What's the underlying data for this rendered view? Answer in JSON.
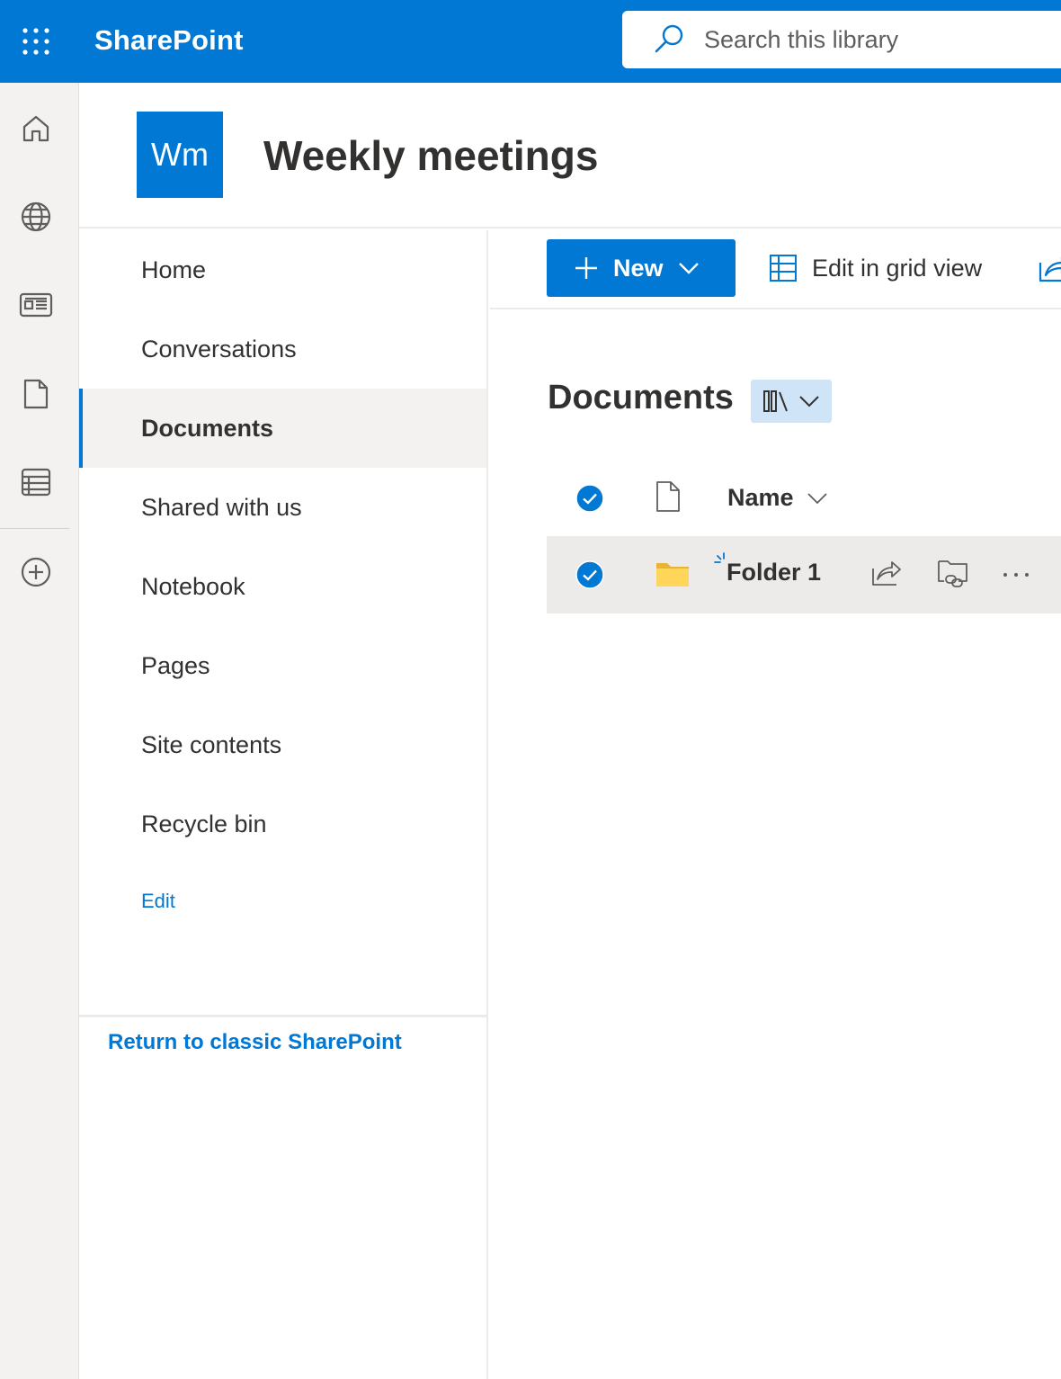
{
  "suite_bar": {
    "app_name": "SharePoint",
    "search_placeholder": "Search this library",
    "colors": {
      "brand": "#0078d4"
    }
  },
  "app_bar": {
    "items": [
      "home-icon",
      "globe-icon",
      "news-icon",
      "document-icon",
      "list-icon",
      "add-circle-icon"
    ]
  },
  "site": {
    "logo_text": "Wm",
    "title": "Weekly meetings"
  },
  "left_nav": {
    "items": [
      {
        "label": "Home",
        "selected": false
      },
      {
        "label": "Conversations",
        "selected": false
      },
      {
        "label": "Documents",
        "selected": true
      },
      {
        "label": "Shared with us",
        "selected": false
      },
      {
        "label": "Notebook",
        "selected": false
      },
      {
        "label": "Pages",
        "selected": false
      },
      {
        "label": "Site contents",
        "selected": false
      },
      {
        "label": "Recycle bin",
        "selected": false
      }
    ],
    "edit_label": "Edit",
    "classic_link": "Return to classic SharePoint"
  },
  "command_bar": {
    "new_label": "New",
    "grid_view_label": "Edit in grid view"
  },
  "library": {
    "title": "Documents",
    "columns": {
      "name": "Name"
    },
    "items": [
      {
        "name": "Folder 1",
        "type": "folder",
        "selected": true,
        "is_new": true
      }
    ]
  }
}
